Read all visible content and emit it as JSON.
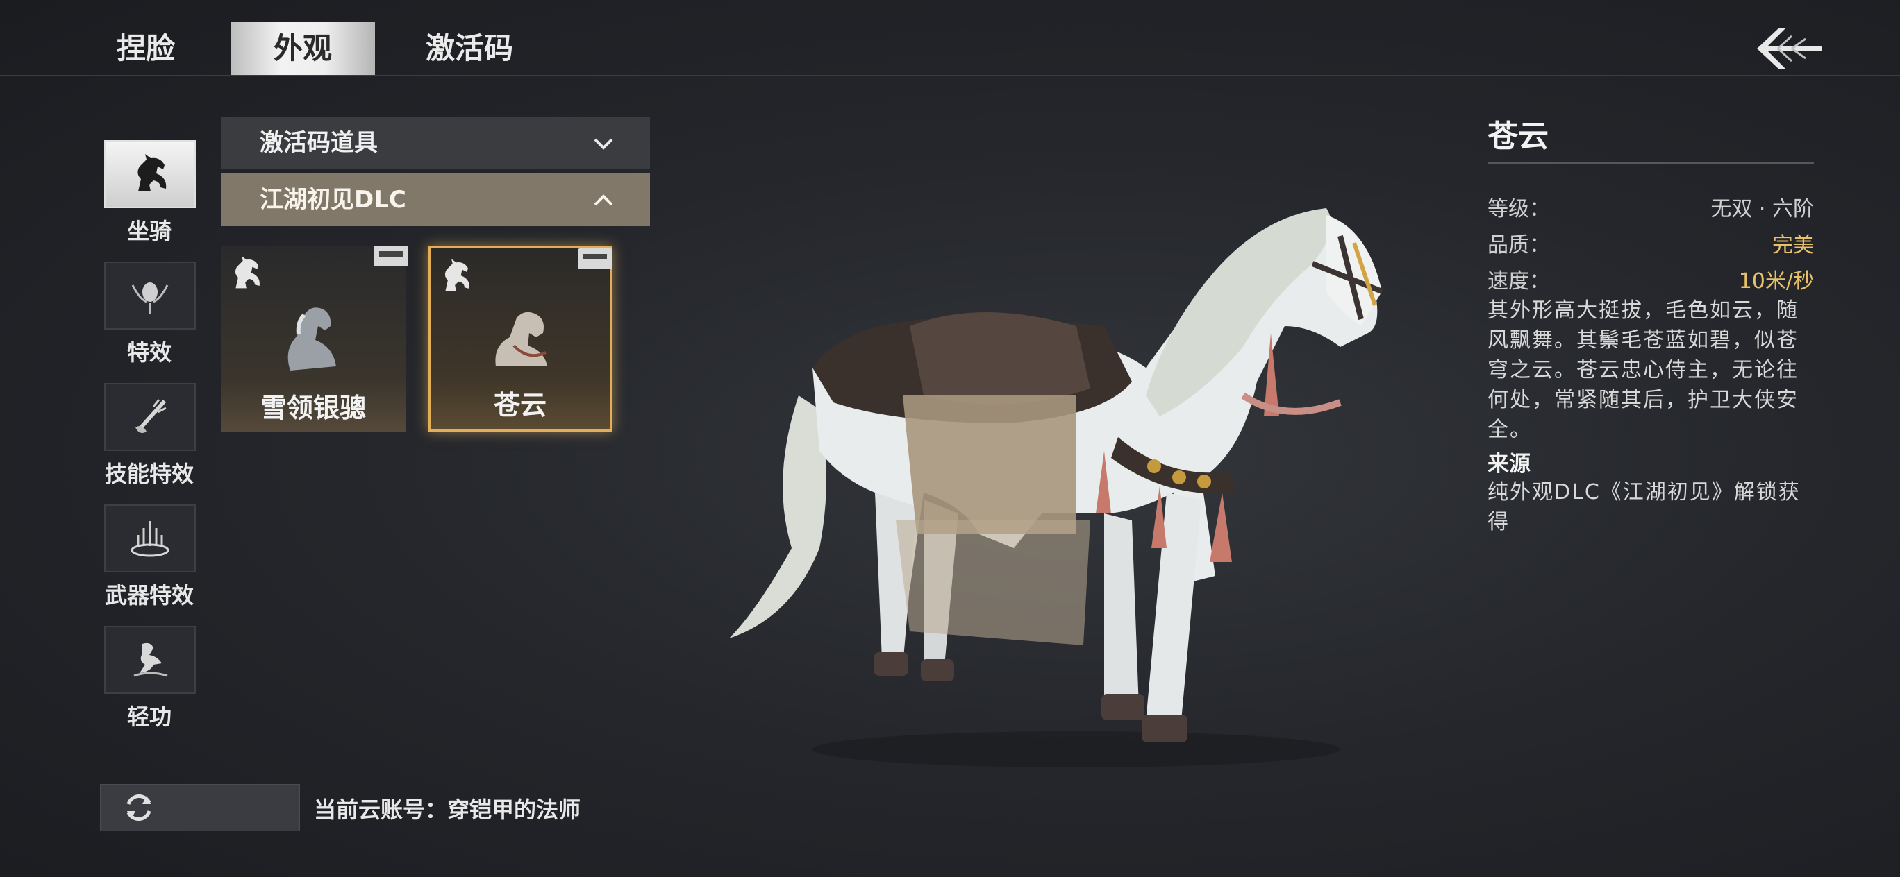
{
  "tabs": [
    {
      "label": "捏脸"
    },
    {
      "label": "外观"
    },
    {
      "label": "激活码"
    }
  ],
  "categories": [
    {
      "label": "坐骑",
      "icon": "horse-icon"
    },
    {
      "label": "特效",
      "icon": "effect-icon"
    },
    {
      "label": "技能特效",
      "icon": "skill-effect-icon"
    },
    {
      "label": "武器特效",
      "icon": "weapon-effect-icon"
    },
    {
      "label": "轻功",
      "icon": "qinggong-icon"
    }
  ],
  "dropdowns": [
    {
      "label": "激活码道具",
      "state": "collapsed"
    },
    {
      "label": "江湖初见DLC",
      "state": "expanded"
    }
  ],
  "items": [
    {
      "name": "雪领银骢",
      "selected": false
    },
    {
      "name": "苍云",
      "selected": true
    }
  ],
  "account": {
    "text": "当前云账号：穿铠甲的法师"
  },
  "detail": {
    "title": "苍云",
    "rows": [
      {
        "key": "等级：",
        "value": "无双 · 六阶"
      },
      {
        "key": "品质：",
        "value": "完美"
      },
      {
        "key": "速度：",
        "value": "10米/秒"
      }
    ],
    "description": "其外形高大挺拔，毛色如云，随风飘舞。其鬃毛苍蓝如碧，似苍穹之云。苍云忠心侍主，无论往何处，常紧随其后，护卫大侠安全。",
    "source_heading": "来源",
    "source_text": "纯外观DLC《江湖初见》解锁获得"
  },
  "colors": {
    "accent_gold": "#e7c26b",
    "selected_border": "#e2ae58"
  }
}
